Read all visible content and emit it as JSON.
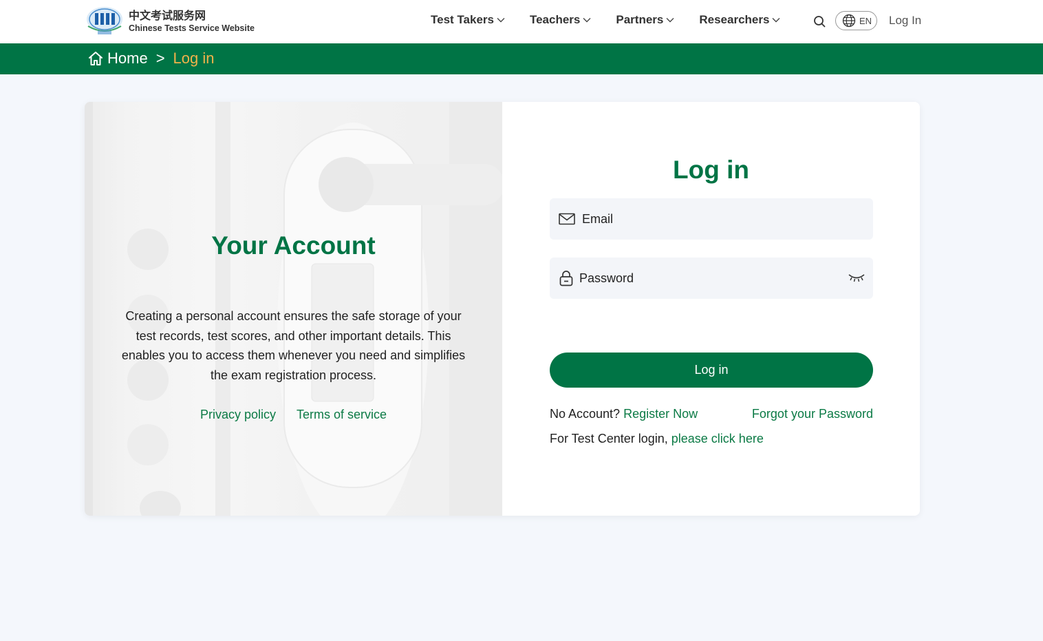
{
  "header": {
    "logo_cn": "中文考试服务网",
    "logo_en": "Chinese Tests Service Website",
    "nav": [
      {
        "label": "Test Takers"
      },
      {
        "label": "Teachers"
      },
      {
        "label": "Partners"
      },
      {
        "label": "Researchers"
      }
    ],
    "lang": "EN",
    "login": "Log In"
  },
  "breadcrumb": {
    "home": "Home",
    "separator": ">",
    "current": "Log in"
  },
  "info": {
    "title": "Your Account",
    "description": "Creating a personal account ensures the safe storage of your test records, test scores, and other important details. This enables you to access them whenever you need and simplifies the exam registration process.",
    "privacy": "Privacy policy",
    "terms": "Terms of service"
  },
  "form": {
    "title": "Log in",
    "email_placeholder": "Email",
    "password_placeholder": "Password",
    "submit": "Log in",
    "no_account": "No Account?",
    "register": "Register Now",
    "forgot": "Forgot your Password",
    "test_center_prefix": "For Test Center login,",
    "test_center_link": "please click here"
  },
  "colors": {
    "brand_green": "#007445",
    "link_green": "#0b7a45",
    "breadcrumb_current": "#f1b24a",
    "page_bg": "#f4f7fc"
  }
}
